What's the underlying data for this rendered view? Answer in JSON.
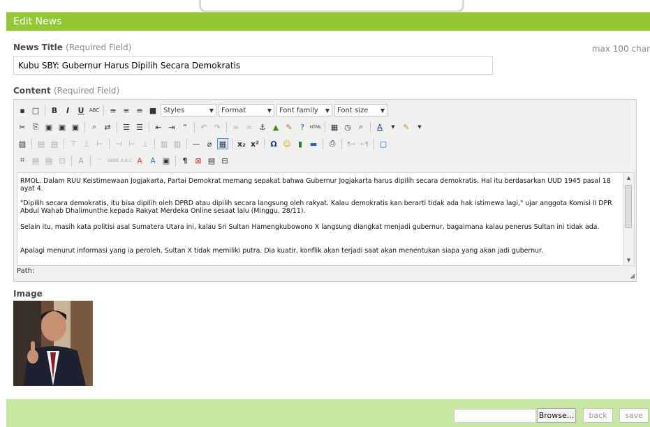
{
  "header": {
    "title": "Edit News"
  },
  "news_title": {
    "label": "News Title",
    "required": "(Required Field)",
    "max_hint": "max 100 char",
    "value": "Kubu SBY: Gubernur Harus Dipilih Secara Demokratis"
  },
  "content": {
    "label": "Content",
    "required": "(Required Field)",
    "toolbar": {
      "styles": "Styles",
      "format": "Format",
      "font_family": "Font family",
      "font_size": "Font size"
    },
    "paragraphs": [
      "RMOL. Dalam RUU Keistimewaan Jogjakarta, Partai Demokrat memang sepakat bahwa Gubernur Jogjakarta harus dipilih secara demokratis. Hal itu berdasarkan UUD 1945 pasal 18 ayat 4.",
      "\"Dipilih secara demokratis, itu bisa dipilih oleh DPRD atau dipilih secara langsung oleh rakyat. Kalau demokratis kan berarti tidak ada hak istimewa lagi,\" ujar anggota Komisi II DPR Abdul Wahab Dhalimunthe kepada Rakyat Merdeka Online sesaat lalu (Minggu, 28/11).",
      "Selain itu, masih kata politisi asal Sumatera Utara ini, kalau Sri Sultan Hamengkubowono X langsung diangkat menjadi gubernur, bagaimana kalau penerus Sultan ini tidak ada.",
      "Apalagi menurut informasi yang ia peroleh, Sultan X tidak memiliki putra. Dia kuatir, konflik akan terjadi saat akan menentukan siapa yang akan jadi gubernur."
    ],
    "path_label": "Path:"
  },
  "image": {
    "label": "Image"
  },
  "footer": {
    "browse": "Browse...",
    "back": "back",
    "save": "save"
  },
  "colors": {
    "header": "#93c832",
    "footer": "#c8e7a0"
  }
}
